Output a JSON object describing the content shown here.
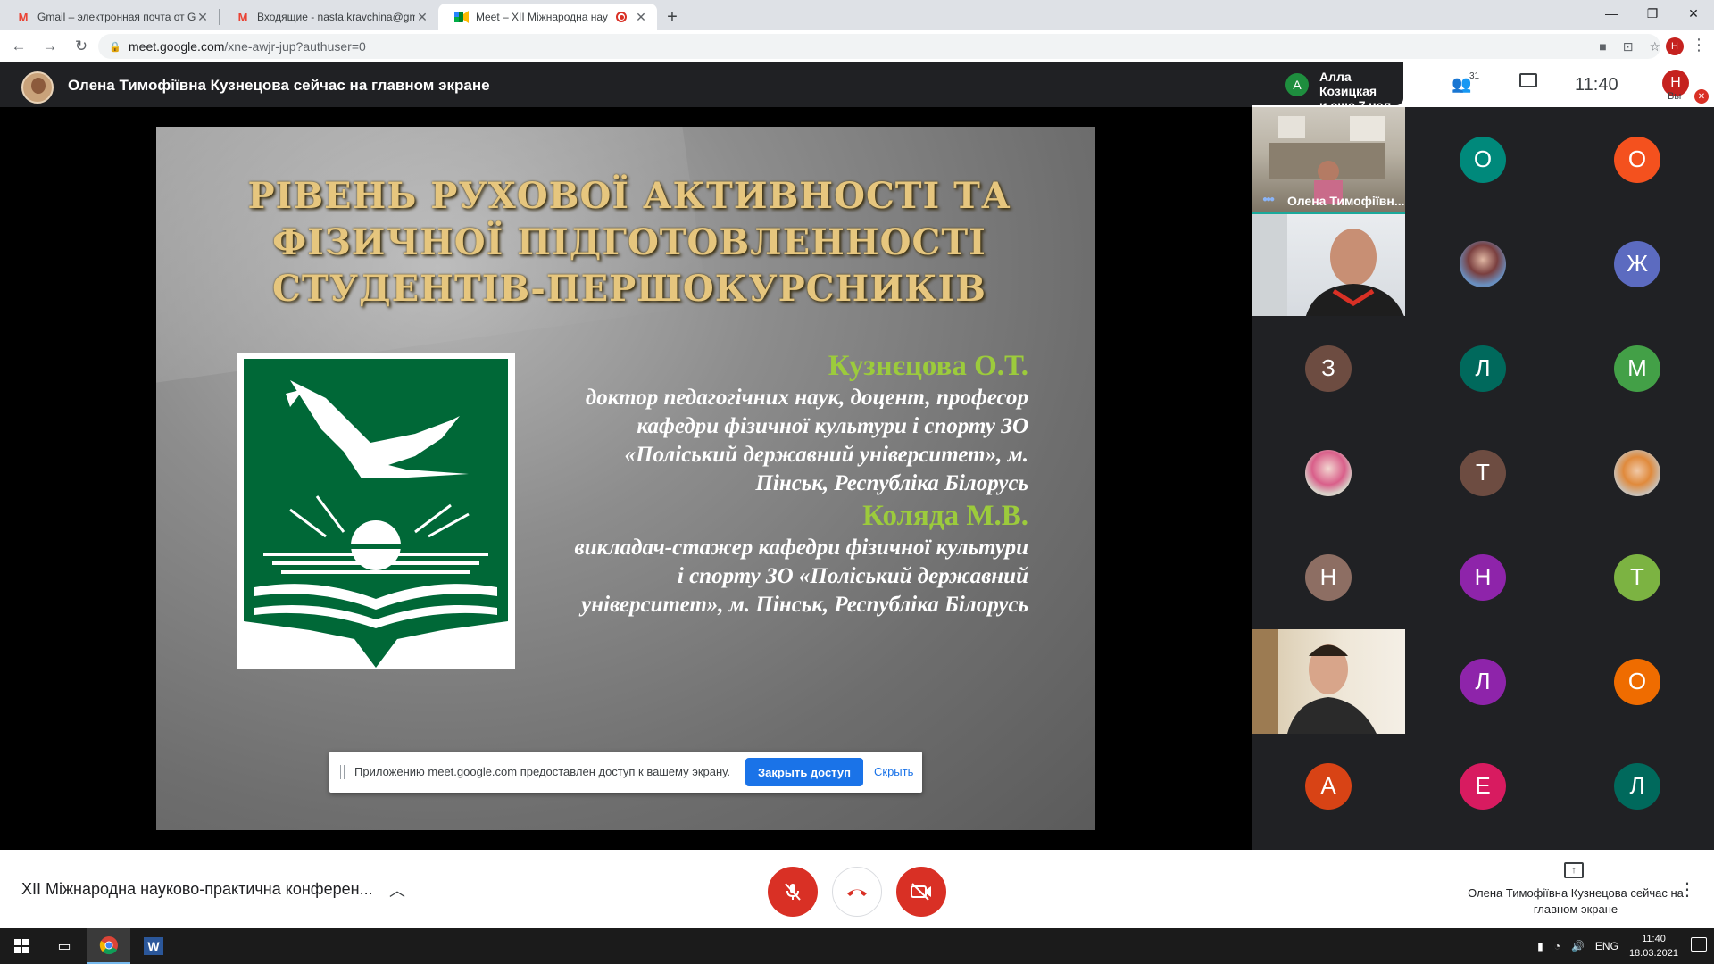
{
  "browser": {
    "tabs": [
      {
        "title": "Gmail – электронная почта от G",
        "icon": "gmail-icon"
      },
      {
        "title": "Входящие - nasta.kravchina@gm",
        "icon": "gmail-icon"
      },
      {
        "title": "Meet – XII Міжнародна нау",
        "icon": "meet-icon",
        "recording": true
      }
    ],
    "url_host": "meet.google.com",
    "url_path": "/xne-awjr-jup?authuser=0",
    "profile_initial": "H"
  },
  "meet": {
    "presenting_banner": "Олена Тимофіївна Кузнецова сейчас на главном экране",
    "others_chip": {
      "initial": "А",
      "line1": "Алла Козицкая",
      "line2": "и еще 7 чел."
    },
    "participants_count": "31",
    "time": "11:40",
    "me_initial": "Н",
    "me_label": "Вы",
    "meeting_title": "XII Міжнародна науково-практична конферен...",
    "present_status": "Олена Тимофіївна Кузнецова сейчас на главном экране"
  },
  "slide": {
    "title": "РІВЕНЬ РУХОВОЇ АКТИВНОСТІ ТА ФІЗИЧНОЇ ПІДГОТОВЛЕННОСТІ СТУДЕНТІВ-ПЕРШОКУРСНИКІВ",
    "author1_name": "Кузнєцова О.Т.",
    "author1_desc": "доктор педагогічних наук, доцент, професор кафедри фізичної культури і спорту ЗО «Поліський державний університет», м. Пінськ, Республіка Білорусь",
    "author2_name": "Коляда М.В.",
    "author2_desc": "викладач-стажер кафедри фізичної культури і спорту ЗО «Поліський державний університет», м. Пінськ, Республіка Білорусь"
  },
  "share_bar": {
    "message": "Приложению meet.google.com предоставлен доступ к вашему экрану.",
    "stop_label": "Закрыть доступ",
    "hide_label": "Скрыть"
  },
  "participants": {
    "self_tile_name": "Олена Тимофіївн...",
    "tiles": [
      {
        "initial": "О",
        "color": "#00897b"
      },
      {
        "initial": "О",
        "color": "#f4511e"
      },
      {
        "initial": "Ж",
        "color": "#5c6bc0"
      },
      {
        "initial": "З",
        "color": "#6d4c41"
      },
      {
        "initial": "Л",
        "color": "#00695c"
      },
      {
        "initial": "М",
        "color": "#43a047"
      },
      {
        "initial": "Т",
        "color": "#6d4c41"
      },
      {
        "initial": "Н",
        "color": "#8d6e63"
      },
      {
        "initial": "Н",
        "color": "#8e24aa"
      },
      {
        "initial": "Т",
        "color": "#7cb342"
      },
      {
        "initial": "Л",
        "color": "#8e24aa"
      },
      {
        "initial": "О",
        "color": "#ef6c00"
      },
      {
        "initial": "А",
        "color": "#d84315"
      },
      {
        "initial": "Е",
        "color": "#d81b60"
      },
      {
        "initial": "Л",
        "color": "#00695c"
      }
    ]
  },
  "taskbar": {
    "lang": "ENG",
    "time": "11:40",
    "date": "18.03.2021"
  }
}
